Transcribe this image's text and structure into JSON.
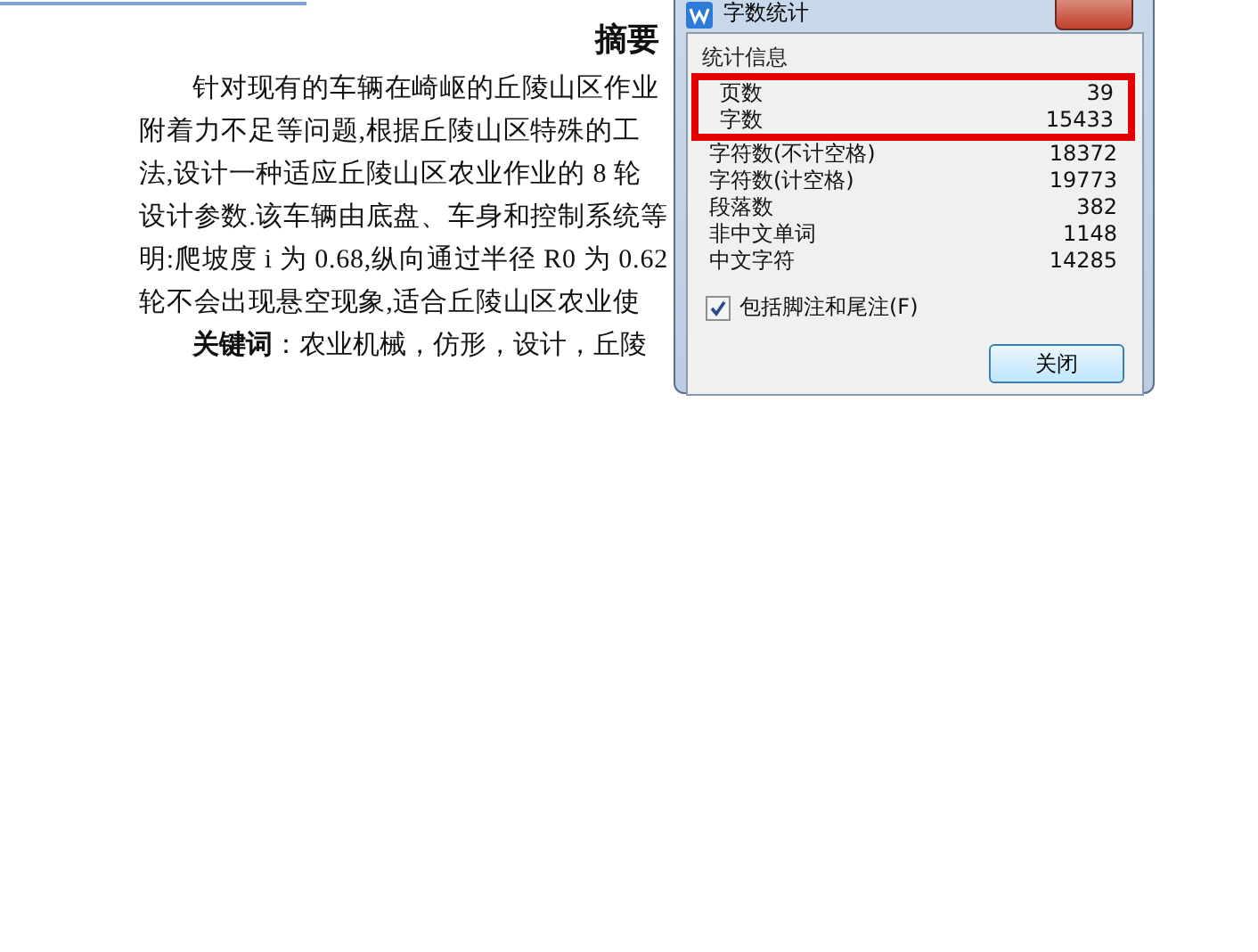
{
  "document": {
    "title": "摘要",
    "lines": [
      "针对现有的车辆在崎岖的丘陵山区作业",
      "附着力不足等问题,根据丘陵山区特殊的工",
      "法,设计一种适应丘陵山区农业作业的 8 轮",
      "设计参数.该车辆由底盘、车身和控制系统等",
      "明:爬坡度 i 为 0.68,纵向通过半径 R0 为 0.62",
      "轮不会出现悬空现象,适合丘陵山区农业使"
    ],
    "keywords_label": "关键词",
    "keywords": "：农业机械，仿形，设计，丘陵"
  },
  "dialog": {
    "title": "字数统计",
    "group": "统计信息",
    "stats": [
      {
        "label": "页数",
        "value": "39",
        "highlighted": true
      },
      {
        "label": "字数",
        "value": "15433",
        "highlighted": true
      },
      {
        "label": "字符数(不计空格)",
        "value": "18372",
        "highlighted": false
      },
      {
        "label": "字符数(计空格)",
        "value": "19773",
        "highlighted": false
      },
      {
        "label": "段落数",
        "value": "382",
        "highlighted": false
      },
      {
        "label": "非中文单词",
        "value": "1148",
        "highlighted": false
      },
      {
        "label": "中文字符",
        "value": "14285",
        "highlighted": false
      }
    ],
    "checkbox": {
      "label": "包括脚注和尾注(F)",
      "checked": true
    },
    "button": "关闭"
  }
}
